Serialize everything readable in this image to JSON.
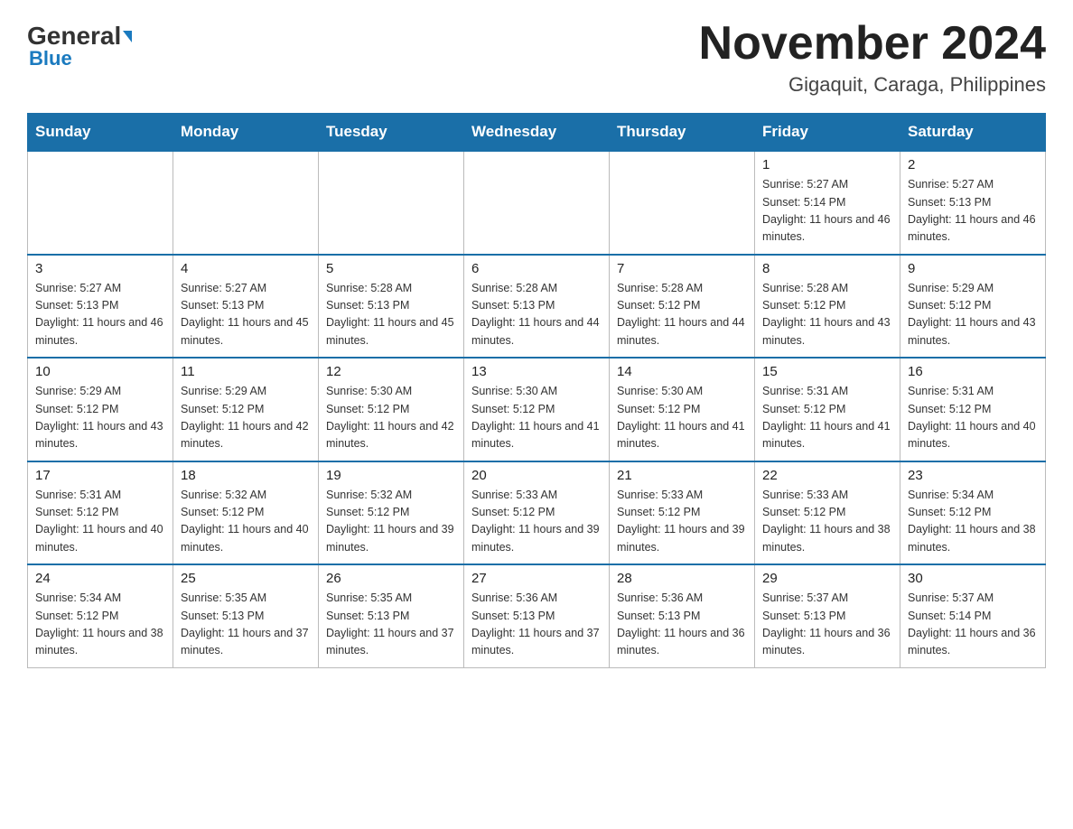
{
  "header": {
    "logo_general": "General",
    "logo_blue": "Blue",
    "month_year": "November 2024",
    "location": "Gigaquit, Caraga, Philippines"
  },
  "weekdays": [
    "Sunday",
    "Monday",
    "Tuesday",
    "Wednesday",
    "Thursday",
    "Friday",
    "Saturday"
  ],
  "weeks": [
    [
      {
        "day": "",
        "info": "",
        "empty": true
      },
      {
        "day": "",
        "info": "",
        "empty": true
      },
      {
        "day": "",
        "info": "",
        "empty": true
      },
      {
        "day": "",
        "info": "",
        "empty": true
      },
      {
        "day": "",
        "info": "",
        "empty": true
      },
      {
        "day": "1",
        "info": "Sunrise: 5:27 AM\nSunset: 5:14 PM\nDaylight: 11 hours and 46 minutes.",
        "empty": false
      },
      {
        "day": "2",
        "info": "Sunrise: 5:27 AM\nSunset: 5:13 PM\nDaylight: 11 hours and 46 minutes.",
        "empty": false
      }
    ],
    [
      {
        "day": "3",
        "info": "Sunrise: 5:27 AM\nSunset: 5:13 PM\nDaylight: 11 hours and 46 minutes.",
        "empty": false
      },
      {
        "day": "4",
        "info": "Sunrise: 5:27 AM\nSunset: 5:13 PM\nDaylight: 11 hours and 45 minutes.",
        "empty": false
      },
      {
        "day": "5",
        "info": "Sunrise: 5:28 AM\nSunset: 5:13 PM\nDaylight: 11 hours and 45 minutes.",
        "empty": false
      },
      {
        "day": "6",
        "info": "Sunrise: 5:28 AM\nSunset: 5:13 PM\nDaylight: 11 hours and 44 minutes.",
        "empty": false
      },
      {
        "day": "7",
        "info": "Sunrise: 5:28 AM\nSunset: 5:12 PM\nDaylight: 11 hours and 44 minutes.",
        "empty": false
      },
      {
        "day": "8",
        "info": "Sunrise: 5:28 AM\nSunset: 5:12 PM\nDaylight: 11 hours and 43 minutes.",
        "empty": false
      },
      {
        "day": "9",
        "info": "Sunrise: 5:29 AM\nSunset: 5:12 PM\nDaylight: 11 hours and 43 minutes.",
        "empty": false
      }
    ],
    [
      {
        "day": "10",
        "info": "Sunrise: 5:29 AM\nSunset: 5:12 PM\nDaylight: 11 hours and 43 minutes.",
        "empty": false
      },
      {
        "day": "11",
        "info": "Sunrise: 5:29 AM\nSunset: 5:12 PM\nDaylight: 11 hours and 42 minutes.",
        "empty": false
      },
      {
        "day": "12",
        "info": "Sunrise: 5:30 AM\nSunset: 5:12 PM\nDaylight: 11 hours and 42 minutes.",
        "empty": false
      },
      {
        "day": "13",
        "info": "Sunrise: 5:30 AM\nSunset: 5:12 PM\nDaylight: 11 hours and 41 minutes.",
        "empty": false
      },
      {
        "day": "14",
        "info": "Sunrise: 5:30 AM\nSunset: 5:12 PM\nDaylight: 11 hours and 41 minutes.",
        "empty": false
      },
      {
        "day": "15",
        "info": "Sunrise: 5:31 AM\nSunset: 5:12 PM\nDaylight: 11 hours and 41 minutes.",
        "empty": false
      },
      {
        "day": "16",
        "info": "Sunrise: 5:31 AM\nSunset: 5:12 PM\nDaylight: 11 hours and 40 minutes.",
        "empty": false
      }
    ],
    [
      {
        "day": "17",
        "info": "Sunrise: 5:31 AM\nSunset: 5:12 PM\nDaylight: 11 hours and 40 minutes.",
        "empty": false
      },
      {
        "day": "18",
        "info": "Sunrise: 5:32 AM\nSunset: 5:12 PM\nDaylight: 11 hours and 40 minutes.",
        "empty": false
      },
      {
        "day": "19",
        "info": "Sunrise: 5:32 AM\nSunset: 5:12 PM\nDaylight: 11 hours and 39 minutes.",
        "empty": false
      },
      {
        "day": "20",
        "info": "Sunrise: 5:33 AM\nSunset: 5:12 PM\nDaylight: 11 hours and 39 minutes.",
        "empty": false
      },
      {
        "day": "21",
        "info": "Sunrise: 5:33 AM\nSunset: 5:12 PM\nDaylight: 11 hours and 39 minutes.",
        "empty": false
      },
      {
        "day": "22",
        "info": "Sunrise: 5:33 AM\nSunset: 5:12 PM\nDaylight: 11 hours and 38 minutes.",
        "empty": false
      },
      {
        "day": "23",
        "info": "Sunrise: 5:34 AM\nSunset: 5:12 PM\nDaylight: 11 hours and 38 minutes.",
        "empty": false
      }
    ],
    [
      {
        "day": "24",
        "info": "Sunrise: 5:34 AM\nSunset: 5:12 PM\nDaylight: 11 hours and 38 minutes.",
        "empty": false
      },
      {
        "day": "25",
        "info": "Sunrise: 5:35 AM\nSunset: 5:13 PM\nDaylight: 11 hours and 37 minutes.",
        "empty": false
      },
      {
        "day": "26",
        "info": "Sunrise: 5:35 AM\nSunset: 5:13 PM\nDaylight: 11 hours and 37 minutes.",
        "empty": false
      },
      {
        "day": "27",
        "info": "Sunrise: 5:36 AM\nSunset: 5:13 PM\nDaylight: 11 hours and 37 minutes.",
        "empty": false
      },
      {
        "day": "28",
        "info": "Sunrise: 5:36 AM\nSunset: 5:13 PM\nDaylight: 11 hours and 36 minutes.",
        "empty": false
      },
      {
        "day": "29",
        "info": "Sunrise: 5:37 AM\nSunset: 5:13 PM\nDaylight: 11 hours and 36 minutes.",
        "empty": false
      },
      {
        "day": "30",
        "info": "Sunrise: 5:37 AM\nSunset: 5:14 PM\nDaylight: 11 hours and 36 minutes.",
        "empty": false
      }
    ]
  ]
}
